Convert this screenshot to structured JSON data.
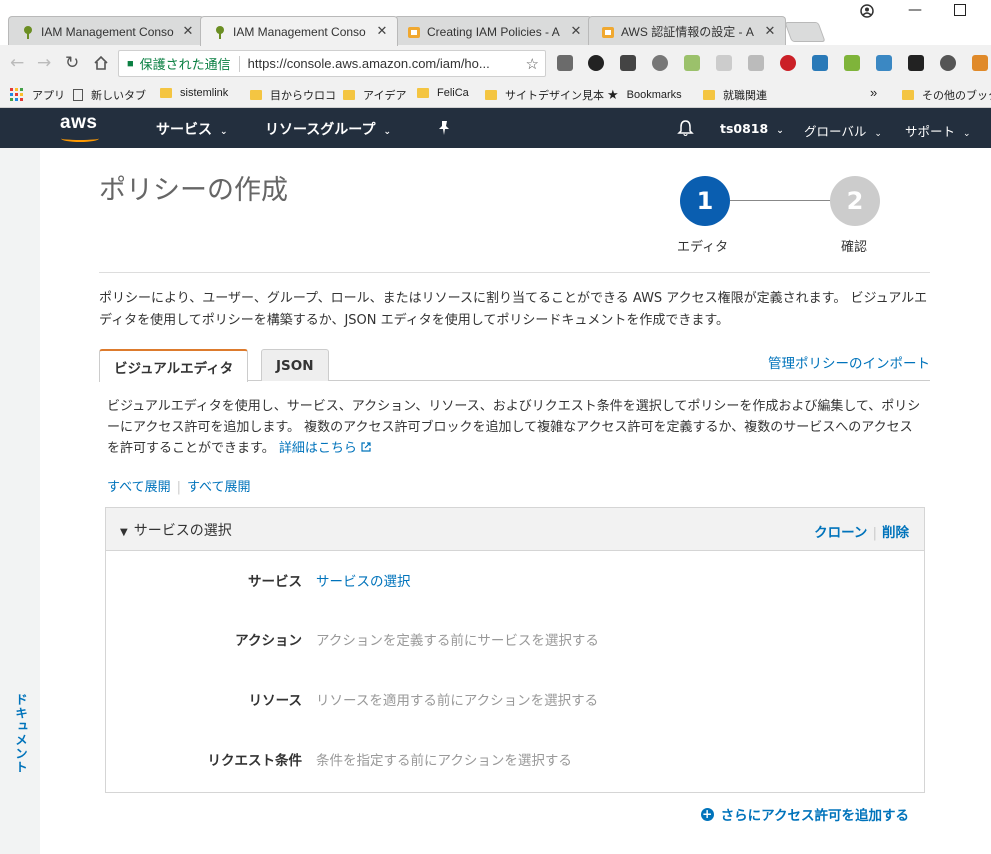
{
  "browser": {
    "tabs": [
      {
        "title": "IAM Management Conso",
        "close": "✕"
      },
      {
        "title": "IAM Management Conso",
        "close": "✕"
      },
      {
        "title": "Creating IAM Policies - A",
        "close": "✕"
      },
      {
        "title": "AWS 認証情報の設定 - A",
        "close": "✕"
      }
    ],
    "omnibox": {
      "secure_label": "保護された通信",
      "url": "https://console.aws.amazon.com/iam/ho..."
    },
    "bookmarks": [
      {
        "label": "アプリ"
      },
      {
        "label": "新しいタブ"
      },
      {
        "label": "sistemlink"
      },
      {
        "label": "目からウロコ"
      },
      {
        "label": "アイデア"
      },
      {
        "label": "FeliCa"
      },
      {
        "label": "サイトデザイン見本"
      },
      {
        "label": "Bookmarks"
      },
      {
        "label": "就職関連"
      },
      {
        "label": "»"
      },
      {
        "label": "その他のブック"
      }
    ]
  },
  "aws_nav": {
    "logo": "aws",
    "services": "サービス",
    "resource_groups": "リソースグループ",
    "user": "ts0818",
    "region": "グローバル",
    "support": "サポート"
  },
  "sidebar": {
    "docs_label": "ドキュメント"
  },
  "page": {
    "title": "ポリシーの作成",
    "steps": [
      {
        "number": "1",
        "label": "エディタ"
      },
      {
        "number": "2",
        "label": "確認"
      }
    ],
    "intro": "ポリシーにより、ユーザー、グループ、ロール、またはリソースに割り当てることができる AWS アクセス権限が定義されます。 ビジュアルエディタを使用してポリシーを構築するか、JSON エディタを使用してポリシードキュメントを作成できます。",
    "tabs": [
      {
        "label": "ビジュアルエディタ"
      },
      {
        "label": "JSON"
      }
    ],
    "import_link": "管理ポリシーのインポート",
    "description": "ビジュアルエディタを使用し、サービス、アクション、リソース、およびリクエスト条件を選択してポリシーを作成および編集して、ポリシーにアクセス許可を追加します。 複数のアクセス許可ブロックを追加して複雑なアクセス許可を定義するか、複数のサービスへのアクセスを許可することができます。",
    "details_link": "詳細はこちら",
    "expand_all_1": "すべて展開",
    "expand_all_2": "すべて展開",
    "panel": {
      "title": "サービスの選択",
      "clone": "クローン",
      "delete": "削除",
      "rows": [
        {
          "key": "サービス",
          "value": "サービスの選択"
        },
        {
          "key": "アクション",
          "value": "アクションを定義する前にサービスを選択する"
        },
        {
          "key": "リソース",
          "value": "リソースを適用する前にアクションを選択する"
        },
        {
          "key": "リクエスト条件",
          "value": "条件を指定する前にアクションを選択する"
        }
      ]
    },
    "add_more": "さらにアクセス許可を追加する"
  }
}
